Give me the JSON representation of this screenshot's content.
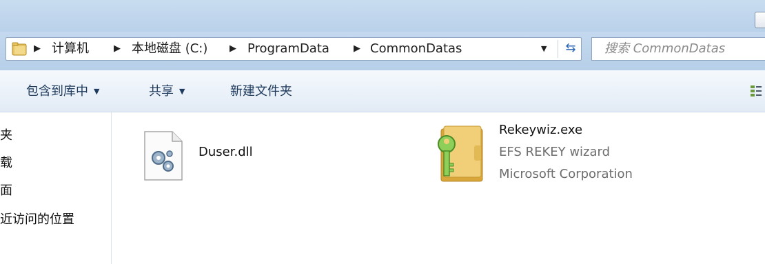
{
  "breadcrumb": {
    "items": [
      "计算机",
      "本地磁盘 (C:)",
      "ProgramData",
      "CommonDatas"
    ]
  },
  "search": {
    "placeholder": "搜索 CommonDatas"
  },
  "toolbar": {
    "include_library_label": "包含到库中",
    "share_label": "共享",
    "new_folder_label": "新建文件夹"
  },
  "nav": {
    "items": [
      "夹",
      "载",
      "面",
      "近访问的位置"
    ]
  },
  "files": [
    {
      "name": "Duser.dll",
      "icon": "dll-file-icon"
    },
    {
      "name": "Rekeywiz.exe",
      "description": "EFS REKEY wizard",
      "company": "Microsoft Corporation",
      "icon": "key-folder-icon"
    }
  ],
  "colors": {
    "chrome_blue": "#b9d1ea",
    "accent": "#2c67b6",
    "meta_gray": "#6d6d6d"
  }
}
